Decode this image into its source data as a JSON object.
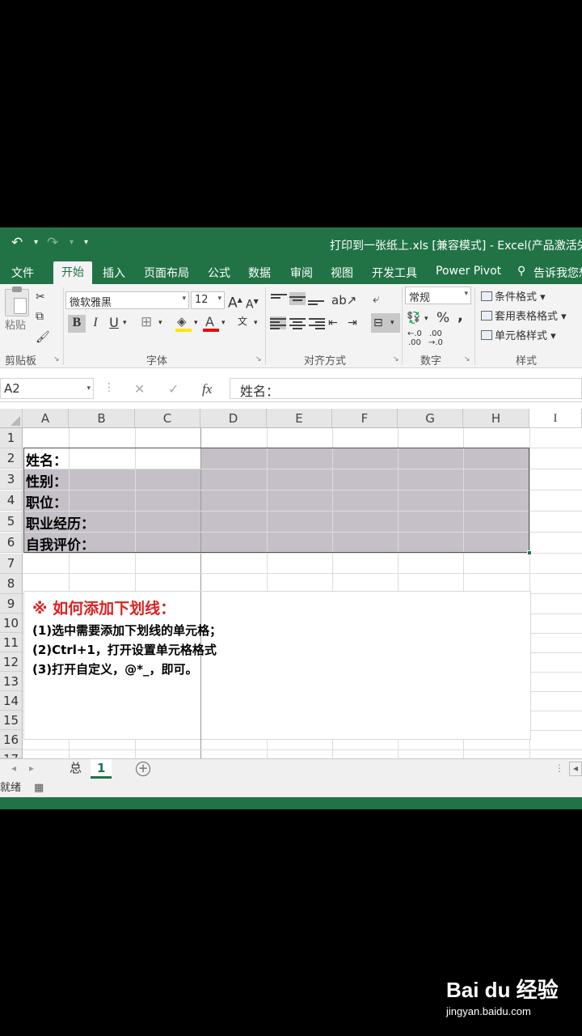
{
  "window": {
    "title": "打印到一张纸上.xls  [兼容模式] - Excel(产品激活失",
    "qa_undo": "↶",
    "qa_redo": "↷",
    "qa_custom": "▾"
  },
  "ribbon": {
    "tabs": [
      "文件",
      "开始",
      "插入",
      "页面布局",
      "公式",
      "数据",
      "审阅",
      "视图",
      "开发工具",
      "Power Pivot",
      "告诉我您想"
    ],
    "active_tab": "开始",
    "clipboard": {
      "label": "剪贴板",
      "paste": "粘贴"
    },
    "font": {
      "label": "字体",
      "name": "微软雅黑",
      "size": "12",
      "bold": "B",
      "italic": "I",
      "underline": "U",
      "phonetic": "wén"
    },
    "alignment": {
      "label": "对齐方式"
    },
    "number": {
      "label": "数字",
      "format": "常规",
      "percent": "%",
      "comma": ","
    },
    "styles": {
      "label": "样式",
      "conditional": "条件格式 ▾",
      "table": "套用表格格式 ▾",
      "cell": "单元格样式 ▾"
    }
  },
  "formula_bar": {
    "name_box": "A2",
    "cancel": "✕",
    "enter": "✓",
    "fx": "fx",
    "content": "姓名："
  },
  "grid": {
    "columns": [
      "A",
      "B",
      "C",
      "D",
      "E",
      "F",
      "G",
      "H",
      "I"
    ],
    "rows": [
      "1",
      "2",
      "3",
      "4",
      "5",
      "6",
      "7",
      "8",
      "9",
      "10",
      "11",
      "12",
      "13",
      "14",
      "15",
      "16",
      "17"
    ],
    "cells": [
      "姓名：",
      "性别：",
      "职位：",
      "职业经历：",
      "自我评价："
    ]
  },
  "textbox": {
    "title": "※ 如何添加下划线：",
    "lines": [
      "(1)选中需要添加下划线的单元格；",
      "(2)Ctrl+1，打开设置单元格格式",
      "(3)打开自定义，@*_，即可。"
    ]
  },
  "sheets": {
    "tabs": [
      "总",
      "1"
    ],
    "active": "1"
  },
  "status": {
    "text": "就绪"
  },
  "watermark": {
    "brand": "Bai du 经验",
    "url": "jingyan.baidu.com"
  },
  "colors": {
    "excel_green": "#217346",
    "selection_fill": "#c5c0c8",
    "title_red": "#e02020"
  }
}
